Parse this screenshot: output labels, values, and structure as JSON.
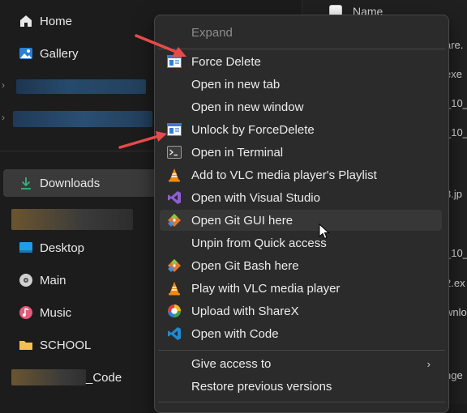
{
  "nav": {
    "items": [
      {
        "label": "Home",
        "icon": "home-icon"
      },
      {
        "label": "Gallery",
        "icon": "gallery-icon"
      },
      {
        "label": "Downloads",
        "icon": "download-icon"
      },
      {
        "label": "Desktop",
        "icon": "desktop-icon"
      },
      {
        "label": "Main",
        "icon": "disc-icon"
      },
      {
        "label": "Music",
        "icon": "music-icon"
      },
      {
        "label": "SCHOOL",
        "icon": "folder-icon"
      },
      {
        "label": "_Code",
        "icon": "folder-icon"
      }
    ],
    "selected": "Downloads"
  },
  "file_list": {
    "header_name": "Name",
    "fragments": [
      "are.",
      "exe",
      "_10_",
      "_10_",
      "3.jp",
      "_10_",
      "2.ex",
      "wnlo",
      "nge"
    ]
  },
  "context_menu": {
    "items": [
      {
        "label": "Expand",
        "icon": "",
        "disabled": true
      },
      {
        "label": "Force Delete",
        "icon": "forcedelete-icon"
      },
      {
        "label": "Open in new tab",
        "icon": ""
      },
      {
        "label": "Open in new window",
        "icon": ""
      },
      {
        "label": "Unlock by ForceDelete",
        "icon": "forcedelete-icon"
      },
      {
        "label": "Open in Terminal",
        "icon": "terminal-icon"
      },
      {
        "label": "Add to VLC media player's Playlist",
        "icon": "vlc-icon"
      },
      {
        "label": "Open with Visual Studio",
        "icon": "visual-studio-icon"
      },
      {
        "label": "Open Git GUI here",
        "icon": "git-icon",
        "hover": true
      },
      {
        "label": "Unpin from Quick access",
        "icon": ""
      },
      {
        "label": "Open Git Bash here",
        "icon": "git-icon"
      },
      {
        "label": "Play with VLC media player",
        "icon": "vlc-icon"
      },
      {
        "label": "Upload with ShareX",
        "icon": "sharex-icon"
      },
      {
        "label": "Open with Code",
        "icon": "vscode-icon"
      },
      {
        "label": "Give access to",
        "icon": "",
        "submenu": true
      },
      {
        "label": "Restore previous versions",
        "icon": ""
      }
    ]
  },
  "colors": {
    "accent": "#e84a4a",
    "selected_bg": "#3a3a3a",
    "menu_bg": "#2b2b2b"
  }
}
